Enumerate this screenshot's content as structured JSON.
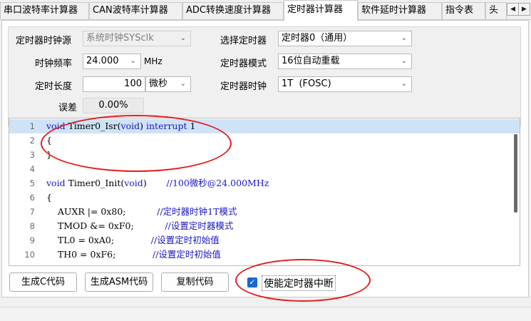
{
  "tabs": [
    {
      "label": "串口波特率计算器",
      "active": false
    },
    {
      "label": "CAN波特率计算器",
      "active": false
    },
    {
      "label": "ADC转换速度计算器",
      "active": false
    },
    {
      "label": "定时器计算器",
      "active": true
    },
    {
      "label": "软件延时计算器",
      "active": false
    },
    {
      "label": "指令表",
      "active": false
    },
    {
      "label": "头",
      "active": false
    }
  ],
  "tab_scroll": {
    "left": "◀",
    "right": "▶"
  },
  "settings": {
    "clock_source_label": "定时器时钟源",
    "clock_source_value": "系统时钟SYSclk",
    "clock_freq_label": "时钟频率",
    "clock_freq_value": "24.000",
    "clock_freq_unit": "MHz",
    "timer_len_label": "定时长度",
    "timer_len_value": "100",
    "timer_len_unit": "微秒",
    "error_label": "误差",
    "error_value": "0.00%",
    "select_timer_label": "选择定时器",
    "select_timer_value": "定时器0（通用）",
    "timer_mode_label": "定时器模式",
    "timer_mode_value": "16位自动重载",
    "timer_clock_label": "定时器时钟",
    "timer_clock_value": "1T  (FOSC)"
  },
  "code_lines": [
    {
      "num": "1",
      "parts": [
        {
          "t": "void",
          "c": "kw"
        },
        {
          "t": " Timer0_Isr(",
          "c": ""
        },
        {
          "t": "void",
          "c": "kw"
        },
        {
          "t": ") ",
          "c": ""
        },
        {
          "t": "interrupt",
          "c": "kw"
        },
        {
          "t": " 1",
          "c": ""
        }
      ]
    },
    {
      "num": "2",
      "parts": [
        {
          "t": "{",
          "c": ""
        }
      ]
    },
    {
      "num": "3",
      "parts": [
        {
          "t": "}",
          "c": ""
        }
      ]
    },
    {
      "num": "4",
      "parts": []
    },
    {
      "num": "5",
      "parts": [
        {
          "t": "void",
          "c": "kw"
        },
        {
          "t": " Timer0_Init(",
          "c": ""
        },
        {
          "t": "void",
          "c": "kw"
        },
        {
          "t": ")       ",
          "c": ""
        },
        {
          "t": "//100微秒@24.000MHz",
          "c": "cm"
        }
      ]
    },
    {
      "num": "6",
      "parts": [
        {
          "t": "{",
          "c": ""
        }
      ]
    },
    {
      "num": "7",
      "parts": [
        {
          "t": "    AUXR |= 0x80;           ",
          "c": ""
        },
        {
          "t": "//定时器时钟1T模式",
          "c": "cm"
        }
      ]
    },
    {
      "num": "8",
      "parts": [
        {
          "t": "    TMOD &= 0xF0;           ",
          "c": ""
        },
        {
          "t": "//设置定时器模式",
          "c": "cm"
        }
      ]
    },
    {
      "num": "9",
      "parts": [
        {
          "t": "    TL0 = 0xA0;             ",
          "c": ""
        },
        {
          "t": "//设置定时初始值",
          "c": "cm"
        }
      ]
    },
    {
      "num": "10",
      "parts": [
        {
          "t": "    TH0 = 0xF6;             ",
          "c": ""
        },
        {
          "t": "//设置定时初始值",
          "c": "cm"
        }
      ]
    }
  ],
  "buttons": {
    "gen_c": "生成C代码",
    "gen_asm": "生成ASM代码",
    "copy_code": "复制代码",
    "enable_interrupt": "使能定时器中断",
    "enable_interrupt_checked": true
  },
  "colors": {
    "accent": "#1a67d2",
    "annotation": "#e21d1d",
    "keyword": "#1b17c2",
    "highlight_line": "#cfe3f6"
  }
}
